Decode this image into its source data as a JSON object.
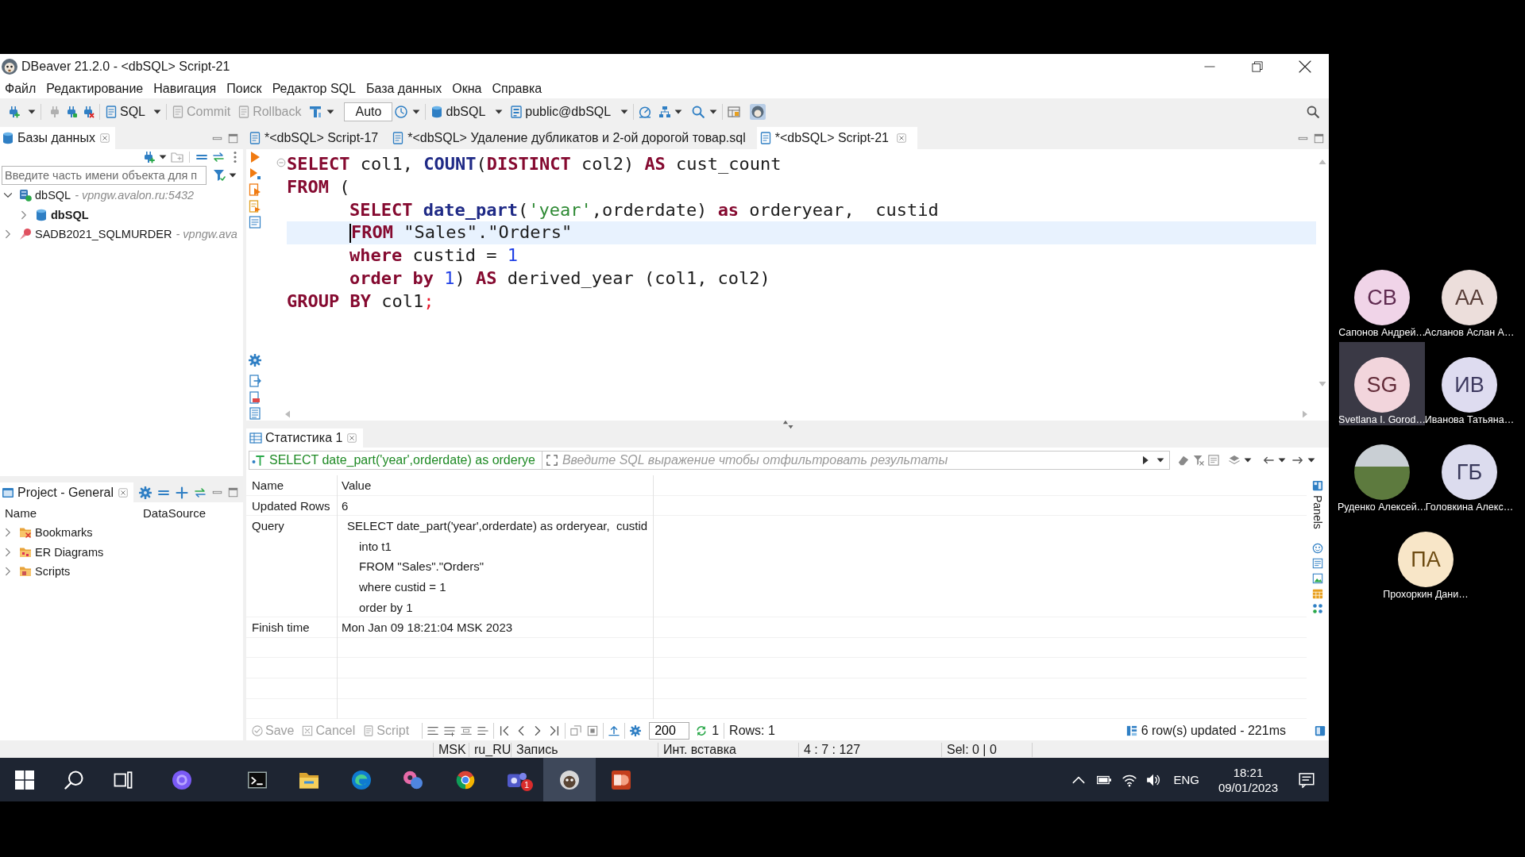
{
  "window": {
    "title": "DBeaver 21.2.0 - <dbSQL> Script-21"
  },
  "menu": [
    "Файл",
    "Редактирование",
    "Навигация",
    "Поиск",
    "Редактор SQL",
    "База данных",
    "Окна",
    "Справка"
  ],
  "toolbar": {
    "editor_button": "SQL",
    "commit": {
      "label": "Commit",
      "disabled": true
    },
    "rollback": {
      "label": "Rollback",
      "disabled": true
    },
    "transaction_mode": "Auto",
    "datasource": "dbSQL",
    "schema": "public@dbSQL"
  },
  "navigator": {
    "title": "Базы данных",
    "filter": {
      "placeholder": "Введите часть имени объекта для п"
    },
    "tree": [
      {
        "label": "dbSQL",
        "detail": "- vpngw.avalon.ru:5432",
        "kind": "connection",
        "connected": true,
        "active": false,
        "expanded": true,
        "children": [
          {
            "label": "dbSQL",
            "kind": "database",
            "active": true,
            "expanded": false
          }
        ]
      },
      {
        "label": "SADB2021_SQLMURDER",
        "detail": "- vpngw.ava",
        "kind": "connection",
        "connected": false,
        "active": false,
        "expanded": false
      }
    ]
  },
  "project": {
    "title": "Project - General",
    "columns": [
      "Name",
      "DataSource"
    ],
    "items": [
      {
        "label": "Bookmarks",
        "kind": "bookmarks",
        "expanded": false
      },
      {
        "label": "ER Diagrams",
        "kind": "diagrams",
        "expanded": false
      },
      {
        "label": "Scripts",
        "kind": "scripts",
        "expanded": false
      }
    ]
  },
  "editor_tabs": [
    {
      "label": "*<dbSQL> Script-17",
      "selected": false
    },
    {
      "label": "*<dbSQL> Удаление дубликатов и 2-ой дорогой товар.sql",
      "selected": false
    },
    {
      "label": "*<dbSQL> Script-21",
      "selected": true
    }
  ],
  "editor": {
    "lines": [
      {
        "current": false,
        "indented": false,
        "tokens": [
          {
            "text": "SELECT",
            "kind": "keyword"
          },
          {
            "text": " col1, ",
            "kind": "plain"
          },
          {
            "text": "COUNT",
            "kind": "function"
          },
          {
            "text": "(",
            "kind": "plain"
          },
          {
            "text": "DISTINCT",
            "kind": "keyword"
          },
          {
            "text": " col2) ",
            "kind": "plain"
          },
          {
            "text": "AS",
            "kind": "keyword"
          },
          {
            "text": " cust_count",
            "kind": "plain"
          }
        ]
      },
      {
        "current": false,
        "indented": false,
        "tokens": [
          {
            "text": "FROM",
            "kind": "keyword"
          },
          {
            "text": " (",
            "kind": "plain"
          }
        ]
      },
      {
        "current": false,
        "indented": true,
        "tokens": [
          {
            "text": "SELECT ",
            "kind": "keyword"
          },
          {
            "text": "date_part",
            "kind": "function"
          },
          {
            "text": "(",
            "kind": "plain"
          },
          {
            "text": "'year'",
            "kind": "string"
          },
          {
            "text": ",orderdate) ",
            "kind": "plain"
          },
          {
            "text": "as",
            "kind": "keyword"
          },
          {
            "text": " orderyear,  custid",
            "kind": "plain"
          }
        ]
      },
      {
        "current": true,
        "indented": true,
        "tokens": [
          {
            "text": "FROM",
            "kind": "keyword"
          },
          {
            "text": " \"Sales\".\"Orders\"",
            "kind": "plain"
          }
        ]
      },
      {
        "current": false,
        "indented": true,
        "tokens": [
          {
            "text": "where",
            "kind": "keyword"
          },
          {
            "text": " custid = ",
            "kind": "plain"
          },
          {
            "text": "1",
            "kind": "number"
          }
        ]
      },
      {
        "current": false,
        "indented": true,
        "tokens": [
          {
            "text": "order by ",
            "kind": "keyword"
          },
          {
            "text": "1",
            "kind": "number"
          },
          {
            "text": ") ",
            "kind": "plain"
          },
          {
            "text": "AS",
            "kind": "keyword"
          },
          {
            "text": " derived_year (col1, col2)",
            "kind": "plain"
          }
        ]
      },
      {
        "current": false,
        "indented": false,
        "tokens": [
          {
            "text": "GROUP BY",
            "kind": "keyword"
          },
          {
            "text": " col1",
            "kind": "plain"
          },
          {
            "text": ";",
            "kind": "delimiter"
          }
        ]
      }
    ]
  },
  "results": {
    "tab": "Статистика 1",
    "query": "SELECT date_part('year',orderdate) as orderye",
    "filter": {
      "placeholder": "Введите SQL выражение чтобы отфильтровать результаты"
    },
    "columns": [
      "Name",
      "Value"
    ],
    "rows": [
      {
        "name": "Updated Rows",
        "value": [
          "6"
        ]
      },
      {
        "name": "Query",
        "value": [
          "SELECT date_part('year',orderdate) as orderyear,  custid",
          "into t1",
          "FROM \"Sales\".\"Orders\"",
          "where custid = 1",
          "order by 1"
        ]
      },
      {
        "name": "Finish time",
        "value": [
          "Mon Jan 09 18:21:04 MSK 2023"
        ]
      }
    ],
    "side_panel": "Panels",
    "actions": [
      {
        "label": "Save",
        "kind": "save",
        "disabled": true
      },
      {
        "label": "Cancel",
        "kind": "cancel",
        "disabled": true
      },
      {
        "label": "Script",
        "kind": "script",
        "disabled": true
      }
    ],
    "fetch_size": "200",
    "result_count": "1",
    "rows_label": "Rows: 1",
    "message": "6 row(s) updated - 221ms"
  },
  "status_bar": [
    "MSK",
    "ru_RU",
    "Запись",
    "Инт. вставка",
    "4 : 7 : 127",
    "Sel: 0 | 0"
  ],
  "participants": [
    {
      "name": "Сапонов Андрей…",
      "initials": "СВ",
      "kind": "initials",
      "color": "#f0d4e8",
      "selected": false
    },
    {
      "name": "Асланов Аслан А…",
      "initials": "АА",
      "kind": "initials",
      "color": "#ecdedb",
      "selected": false
    },
    {
      "name": "Svetlana I. Gorod…",
      "initials": "SG",
      "kind": "initials",
      "color": "#f2d5dc",
      "selected": true
    },
    {
      "name": "Иванова Татьяна…",
      "initials": "ИВ",
      "kind": "initials",
      "color": "#dedcf0",
      "selected": false
    },
    {
      "name": "Руденко Алексей…",
      "kind": "photo",
      "selected": false
    },
    {
      "name": "Головкина Алекс…",
      "initials": "ГБ",
      "kind": "initials",
      "color": "#dcdcee",
      "selected": false
    },
    {
      "name": "Прохоркин Дани…",
      "initials": "ПА",
      "kind": "initials",
      "color": "#f8e6c8",
      "selected": false
    }
  ],
  "taskbar": {
    "apps": [
      {
        "kind": "start",
        "selected": false
      },
      {
        "kind": "search",
        "selected": false
      },
      {
        "kind": "task_view",
        "selected": false
      },
      {
        "kind": "assistant",
        "selected": false
      },
      {
        "kind": "terminal",
        "selected": false
      },
      {
        "kind": "files",
        "selected": false
      },
      {
        "kind": "browser_edge",
        "selected": false
      },
      {
        "kind": "tool",
        "selected": false
      },
      {
        "kind": "browser_chrome",
        "selected": false
      },
      {
        "kind": "teams",
        "selected": false,
        "badge": "1"
      },
      {
        "kind": "dbeaver",
        "selected": true
      },
      {
        "kind": "slides",
        "selected": false
      }
    ],
    "language": "ENG",
    "time": "18:21",
    "date": "09/01/2023"
  }
}
